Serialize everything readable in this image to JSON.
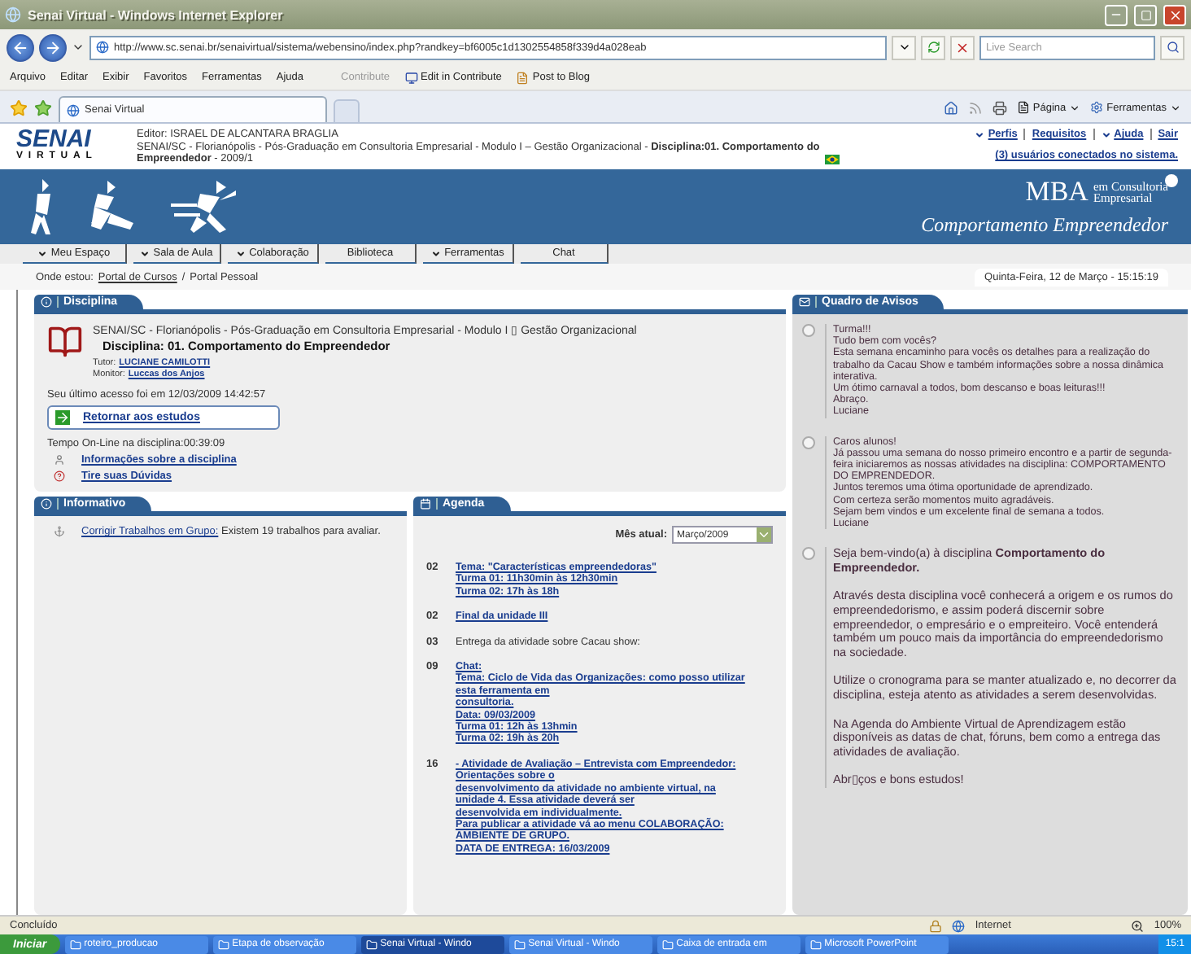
{
  "window": {
    "title": "Senai Virtual - Windows Internet Explorer"
  },
  "address_bar": {
    "url": "http://www.sc.senai.br/senaivirtual/sistema/webensino/index.php?randkey=bf6005c1d1302554858f339d4a028eab"
  },
  "search": {
    "placeholder": "Live Search"
  },
  "menu_bar": [
    "Arquivo",
    "Editar",
    "Exibir",
    "Favoritos",
    "Ferramentas",
    "Ajuda"
  ],
  "contribute": {
    "label": "Contribute",
    "buttons": [
      "Edit in Contribute",
      "Post to Blog"
    ]
  },
  "browser_tab": {
    "label": "Senai Virtual"
  },
  "command_bar": [
    "Página",
    "Ferramentas"
  ],
  "site_header": {
    "logo": "SENAI",
    "logo_sub": "VIRTUAL",
    "editor": "Editor: ISRAEL DE ALCANTARA BRAGLIA",
    "path": "SENAI/SC - Florianópolis - Pós-Graduação em Consultoria Empresarial - Modulo I – Gestão Organizacional - **Disciplina:01. Comportamento do Empreendedor** - 2009/1",
    "links": [
      {
        "label": "Perfis",
        "has_menu": true
      },
      {
        "label": "Requisitos",
        "has_menu": false
      },
      {
        "label": "Ajuda",
        "has_menu": true
      },
      {
        "label": "Sair",
        "has_menu": false
      }
    ],
    "users_online": "(3) usuários conectados no sistema."
  },
  "banner": {
    "brand": "MBA",
    "brand_sub": [
      "em Consultoria",
      "Empresarial"
    ],
    "course": "Comportamento Empreendedor"
  },
  "nav": [
    {
      "label": "Meu Espaço",
      "has_menu": true
    },
    {
      "label": "Sala de Aula",
      "has_menu": true
    },
    {
      "label": "Colaboração",
      "has_menu": true
    },
    {
      "label": "Biblioteca",
      "has_menu": false
    },
    {
      "label": "Ferramentas",
      "has_menu": true
    },
    {
      "label": "Chat",
      "has_menu": false
    }
  ],
  "breadcrumb": {
    "prefix": "Onde estou:",
    "items": [
      "Portal de Cursos",
      "Portal Pessoal"
    ],
    "separator": "/",
    "datetime": "Quinta-Feira, 12 de Março - 15:15:19"
  },
  "disciplina": {
    "title": "Disciplina",
    "course": "SENAI/SC - Florianópolis - Pós-Graduação em Consultoria Empresarial - Modulo I ▯ Gestão Organizacional",
    "name": "Disciplina: 01. Comportamento do Empreendedor",
    "tutor": {
      "label": "Tutor:",
      "name": "LUCIANE CAMILOTTI"
    },
    "monitor": {
      "label": "Monitor:",
      "name": "Luccas dos Anjos"
    },
    "last_access": "Seu último acesso foi em 12/03/2009 14:42:57",
    "return_button": "Retornar aos estudos",
    "online_time": "Tempo On-Line na disciplina:00:39:09",
    "links": [
      "Informações sobre a disciplina",
      "Tire suas Dúvidas"
    ]
  },
  "informativo": {
    "title": "Informativo",
    "items": [
      {
        "link": "Corrigir Trabalhos em Grupo:",
        "text": "Existem 19 trabalhos para avaliar."
      }
    ]
  },
  "agenda": {
    "title": "Agenda",
    "month_label": "Mês atual:",
    "month": "Março/2009",
    "entries": [
      {
        "day": "02",
        "link": true,
        "lines": [
          "Tema: \"Características empreendedoras\"",
          "Turma 01: 11h30min às 12h30min",
          "Turma 02: 17h às 18h"
        ]
      },
      {
        "day": "02",
        "link": true,
        "lines": [
          "Final da unidade III"
        ]
      },
      {
        "day": "03",
        "link": false,
        "lines": [
          "Entrega da atividade sobre Cacau show:"
        ]
      },
      {
        "day": "09",
        "link": true,
        "lines": [
          "Chat:",
          "Tema: Ciclo de Vida das Organizações: como posso utilizar",
          "esta ferramenta em",
          "consultoria.",
          "Data: 09/03/2009",
          "Turma 01: 12h às 13hmin",
          "Turma 02: 19h às 20h"
        ]
      },
      {
        "day": "16",
        "link": true,
        "lines": [
          "- Atividade de Avaliação – Entrevista com Empreendedor:",
          "Orientações sobre o",
          "desenvolvimento da atividade no ambiente virtual, na",
          "unidade 4. Essa atividade deverá ser",
          "desenvolvida em individualmente.",
          "Para publicar a atividade vá ao menu COLABORAÇÃO:",
          "AMBIENTE DE GRUPO.",
          "DATA DE ENTREGA: 16/03/2009"
        ]
      }
    ]
  },
  "avisos": {
    "title": "Quadro de Avisos",
    "notices": [
      {
        "kind": "note",
        "lines": [
          "Turma!!!",
          "Tudo bem com vocês?",
          "Esta semana encaminho para vocês os detalhes para a realização do trabalho da Cacau Show e também informações sobre a nossa dinâmica interativa.",
          "Um ótimo carnaval a todos, bom descanso e boas leituras!!!",
          "Abraço.",
          "Luciane"
        ]
      },
      {
        "kind": "note",
        "lines": [
          "Caros alunos!",
          "Já passou uma semana do nosso primeiro encontro e a partir de segunda-feira iniciaremos as nossas atividades na disciplina: COMPORTAMENTO DO EMPRENDEDOR.",
          "Juntos teremos uma ótima oportunidade de aprendizado.",
          "Com certeza serão momentos muito agradáveis.",
          "Sejam bem vindos e um excelente final de semana a todos.",
          "Luciane"
        ]
      },
      {
        "kind": "welcome",
        "lines": [
          "Seja bem-vindo(a) à disciplina **Comportamento do Empreendedor.**",
          "Através desta disciplina você conhecerá a origem e os rumos do empreendedorismo, e assim poderá discernir sobre empreendedor, o empresário e o empreiteiro. Você entenderá também um pouco mais da importância do empreendedorismo na sociedade.",
          "Utilize o cronograma para se manter atualizado e, no decorrer da disciplina, esteja atento as atividades a serem desenvolvidas.",
          "Na Agenda do Ambiente Virtual de Aprendizagem estão disponíveis as datas de chat, fóruns, bem como a entrega das atividades de avaliação.",
          "Abr▯ços e bons estudos!"
        ]
      }
    ]
  },
  "status_bar": {
    "text": "Concluído",
    "zone": "Internet",
    "zoom": "100%"
  },
  "taskbar": {
    "start": "Iniciar",
    "tasks": [
      {
        "label": "roteiro_producao",
        "selected": false
      },
      {
        "label": "Etapa de observação",
        "selected": false
      },
      {
        "label": "Senai Virtual - Windo",
        "selected": true
      },
      {
        "label": "Senai Virtual - Windo",
        "selected": false
      },
      {
        "label": "Caixa de entrada em",
        "selected": false
      },
      {
        "label": "Microsoft PowerPoint",
        "selected": false
      }
    ],
    "clock": "15:1"
  }
}
